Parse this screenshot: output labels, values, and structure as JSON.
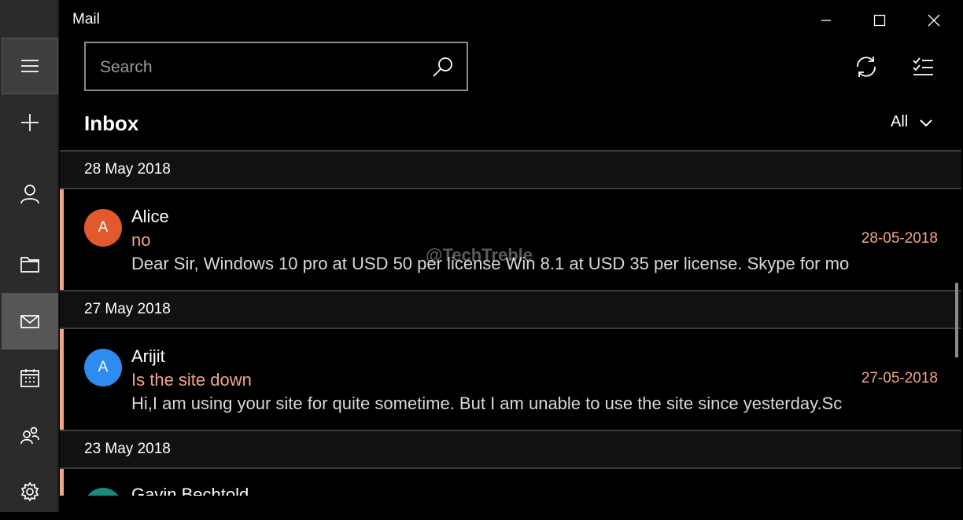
{
  "app": {
    "title": "Mail"
  },
  "window_controls": [
    "minimize",
    "maximize",
    "close"
  ],
  "rail": {
    "items": [
      {
        "name": "menu",
        "icon": "hamburger-icon"
      },
      {
        "name": "new-mail",
        "icon": "plus-icon"
      },
      {
        "name": "accounts",
        "icon": "person-icon"
      },
      {
        "name": "folders",
        "icon": "folder-icon"
      },
      {
        "name": "mail",
        "icon": "mail-icon",
        "active": true
      },
      {
        "name": "calendar",
        "icon": "calendar-icon"
      },
      {
        "name": "people",
        "icon": "people-icon"
      },
      {
        "name": "settings",
        "icon": "gear-icon"
      }
    ]
  },
  "search": {
    "placeholder": "Search",
    "value": ""
  },
  "toolbar": {
    "sync_icon": "sync-icon",
    "select_icon": "select-mode-icon"
  },
  "folder": {
    "title": "Inbox",
    "filter": "All"
  },
  "groups": [
    {
      "date": "28 May 2018",
      "messages": [
        {
          "avatar_letter": "A",
          "avatar_color": "#e05a2b",
          "sender": "Alice",
          "subject": "no",
          "preview": "Dear Sir, Windows 10 pro at USD 50 per license Win 8.1 at USD 35 per license. Skype for mor",
          "date": "28-05-2018"
        }
      ]
    },
    {
      "date": "27 May 2018",
      "messages": [
        {
          "avatar_letter": "A",
          "avatar_color": "#2d8cf0",
          "sender": "Arijit",
          "subject": "Is the site down",
          "preview": "Hi,I am using your site for quite sometime. But I am unable to use the site since yesterday.Sc",
          "date": "27-05-2018"
        }
      ]
    },
    {
      "date": "23 May 2018",
      "messages": [
        {
          "avatar_color": "#1a8a7a",
          "sender": "Gavin Bechtold"
        }
      ]
    }
  ],
  "watermark": "@TechTreble",
  "colors": {
    "accent": "#f0a48a",
    "background": "#000000",
    "rail": "#2b2b2b"
  }
}
